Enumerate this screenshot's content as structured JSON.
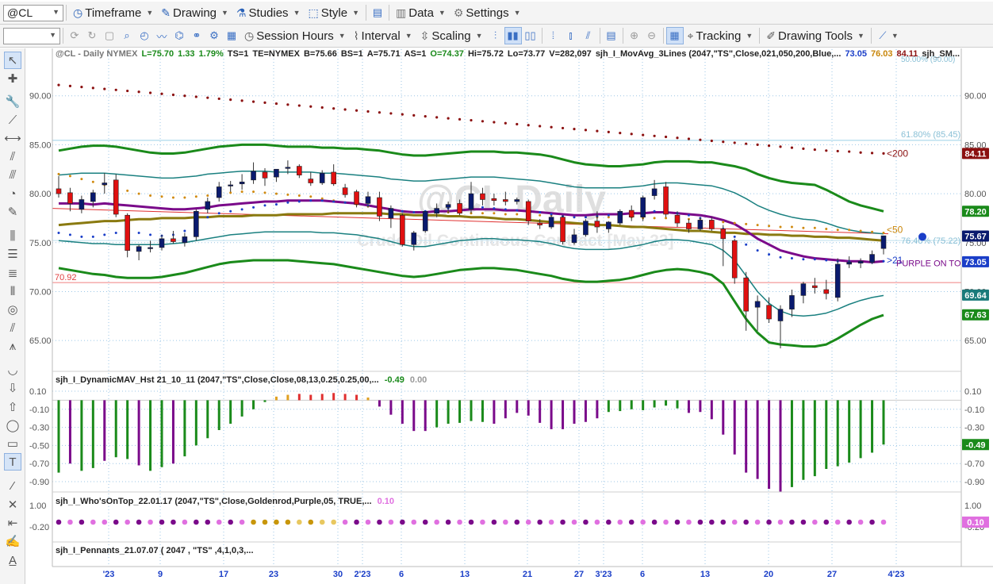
{
  "toolbar1": {
    "symbol": "@CL",
    "timeframe": "Timeframe",
    "drawing": "Drawing",
    "studies": "Studies",
    "style": "Style",
    "data": "Data",
    "settings": "Settings"
  },
  "toolbar2": {
    "session_hours": "Session Hours",
    "interval": "Interval",
    "scaling": "Scaling",
    "tracking": "Tracking",
    "drawing_tools": "Drawing Tools"
  },
  "watermark": {
    "title": "@CL Daily",
    "subtitle": "Crude Oil Continuous Contract [May 23]"
  },
  "info_bar": [
    {
      "text": "@CL - Daily  NYMEX",
      "color": "#777777"
    },
    {
      "text": "L=75.70",
      "color": "#1a8a1a"
    },
    {
      "text": "1.33",
      "color": "#1a8a1a"
    },
    {
      "text": "1.79%",
      "color": "#1a8a1a"
    },
    {
      "text": "TS=1",
      "color": "#222222"
    },
    {
      "text": "TE=NYMEX",
      "color": "#222222"
    },
    {
      "text": "B=75.66",
      "color": "#222222"
    },
    {
      "text": "BS=1",
      "color": "#222222"
    },
    {
      "text": "A=75.71",
      "color": "#222222"
    },
    {
      "text": "AS=1",
      "color": "#222222"
    },
    {
      "text": "O=74.37",
      "color": "#1a8a1a"
    },
    {
      "text": "Hi=75.72",
      "color": "#222222"
    },
    {
      "text": "Lo=73.77",
      "color": "#222222"
    },
    {
      "text": "V=282,097",
      "color": "#222222"
    },
    {
      "text": "sjh_I_MovAvg_3Lines (2047,\"TS\",Close,021,050,200,Blue,...",
      "color": "#222222"
    },
    {
      "text": "73.05",
      "color": "#1a3ec8"
    },
    {
      "text": "76.03",
      "color": "#c8860a"
    },
    {
      "text": "84.11",
      "color": "#8b1010"
    },
    {
      "text": "sjh_SM...",
      "color": "#222222"
    }
  ],
  "price_axis": {
    "ticks": [
      "90.00",
      "85.00",
      "80.00",
      "75.00",
      "70.00",
      "65.00"
    ],
    "min": 62.5,
    "max": 93.3,
    "badges": [
      {
        "text": "84.11",
        "value": 84.11,
        "bg": "#8b1010"
      },
      {
        "text": "78.20",
        "value": 78.2,
        "bg": "#1a8a1a"
      },
      {
        "text": "75.67",
        "value": 75.67,
        "bg": "#0a1a6e"
      },
      {
        "text": "73.05",
        "value": 73.05,
        "bg": "#1a3ec8"
      },
      {
        "text": "69.64",
        "value": 69.64,
        "bg": "#1a7a7a"
      },
      {
        "text": "67.63",
        "value": 67.63,
        "bg": "#1a8a1a"
      }
    ]
  },
  "annotations": {
    "fib_618": "61.80% (85.45)",
    "fib_partial": "76.40% (75.22)",
    "top_partial": "50.00% (90.00)",
    "level_label": "70.92",
    "ma200": "<200",
    "ma50": "<50",
    "ma21": ">21",
    "purple_on_top": "PURPLE ON TO"
  },
  "x_axis": {
    "labels": [
      {
        "text": "'23",
        "pos": 137
      },
      {
        "text": "9",
        "pos": 202
      },
      {
        "text": "17",
        "pos": 282
      },
      {
        "text": "23",
        "pos": 345
      },
      {
        "text": "30",
        "pos": 426
      },
      {
        "text": "2'23",
        "pos": 457
      },
      {
        "text": "6",
        "pos": 506
      },
      {
        "text": "13",
        "pos": 586
      },
      {
        "text": "21",
        "pos": 665
      },
      {
        "text": "27",
        "pos": 730
      },
      {
        "text": "3'23",
        "pos": 761
      },
      {
        "text": "6",
        "pos": 810
      },
      {
        "text": "13",
        "pos": 889
      },
      {
        "text": "20",
        "pos": 969
      },
      {
        "text": "27",
        "pos": 1049
      },
      {
        "text": "4'23",
        "pos": 1130
      }
    ]
  },
  "osc_panel": {
    "label": "sjh_I_DynamicMAV_Hst 21_10_11 (2047,\"TS\",Close,Close,08,13,0.25,0.25,00,...",
    "value1": "-0.49",
    "value2": "0.00",
    "ticks": [
      "0.10",
      "-0.10",
      "-0.30",
      "-0.50",
      "-0.70",
      "-0.90"
    ],
    "badge": "-0.49"
  },
  "who_panel": {
    "label": "sjh_I_Who'sOnTop_22.01.17 (2047,\"TS\",Close,Goldenrod,Purple,05, TRUE,...",
    "value": "0.10",
    "ticks": [
      "1.00",
      "-0.20"
    ],
    "badge": "0.10"
  },
  "pennant_panel": {
    "label": "sjh_I_Pennants_21.07.07 ( 2047 , \"TS\" ,4,1,0,3,..."
  },
  "colors": {
    "bull": "#0a1a6e",
    "bear": "#e01010",
    "ma_purple": "#7a0a8a",
    "ma_olive": "#8a7a10",
    "band_green": "#1a8a1a",
    "band_teal": "#1a8080",
    "dot_red": "#8b1010",
    "dot_gold": "#d08a10",
    "dot_blue": "#1a3ec8"
  },
  "chart_data": {
    "type": "candlestick",
    "note_axes": "price panel",
    "ohlc": [
      [
        80.5,
        81.8,
        79.6,
        80.0
      ],
      [
        80.1,
        80.6,
        78.2,
        79.0
      ],
      [
        78.4,
        79.8,
        78.0,
        79.4
      ],
      [
        79.2,
        80.4,
        78.6,
        80.1
      ],
      [
        80.9,
        82.1,
        80.0,
        81.1
      ],
      [
        81.4,
        82.0,
        77.6,
        77.9
      ],
      [
        77.8,
        78.0,
        73.5,
        74.2
      ],
      [
        74.1,
        74.8,
        73.2,
        74.6
      ],
      [
        74.4,
        75.2,
        74.0,
        74.5
      ],
      [
        74.5,
        75.8,
        74.2,
        75.4
      ],
      [
        75.4,
        76.2,
        74.9,
        75.1
      ],
      [
        75.0,
        76.0,
        74.6,
        75.6
      ],
      [
        75.6,
        78.4,
        75.2,
        78.2
      ],
      [
        78.4,
        79.6,
        78.0,
        79.2
      ],
      [
        79.6,
        81.2,
        79.2,
        80.7
      ],
      [
        80.8,
        81.3,
        80.2,
        80.9
      ],
      [
        81.0,
        82.0,
        80.4,
        81.2
      ],
      [
        81.4,
        83.2,
        81.0,
        82.3
      ],
      [
        82.2,
        82.6,
        80.8,
        81.6
      ],
      [
        81.7,
        82.5,
        81.2,
        82.5
      ],
      [
        82.6,
        83.4,
        82.0,
        82.7
      ],
      [
        82.8,
        83.0,
        81.6,
        81.9
      ],
      [
        81.5,
        82.2,
        80.8,
        81.1
      ],
      [
        81.1,
        82.4,
        80.9,
        82.1
      ],
      [
        82.2,
        83.0,
        80.8,
        81.0
      ],
      [
        80.6,
        81.0,
        79.6,
        79.9
      ],
      [
        80.2,
        80.4,
        78.6,
        78.9
      ],
      [
        79.0,
        80.2,
        78.6,
        79.7
      ],
      [
        79.6,
        80.2,
        77.2,
        77.7
      ],
      [
        77.5,
        78.8,
        76.5,
        78.5
      ],
      [
        77.8,
        78.0,
        74.6,
        74.8
      ],
      [
        74.8,
        76.2,
        74.2,
        76.0
      ],
      [
        76.2,
        78.2,
        76.0,
        78.2
      ],
      [
        78.0,
        79.0,
        77.6,
        78.5
      ],
      [
        78.6,
        79.2,
        78.0,
        78.9
      ],
      [
        79.0,
        79.4,
        77.8,
        78.0
      ],
      [
        78.4,
        81.2,
        78.0,
        80.0
      ],
      [
        80.0,
        80.6,
        78.8,
        79.4
      ],
      [
        79.5,
        80.0,
        78.8,
        79.3
      ],
      [
        79.4,
        80.2,
        78.8,
        79.2
      ],
      [
        79.2,
        79.6,
        78.9,
        79.4
      ],
      [
        79.2,
        79.4,
        76.8,
        77.2
      ],
      [
        77.0,
        77.4,
        76.4,
        76.8
      ],
      [
        76.6,
        77.8,
        76.4,
        77.6
      ],
      [
        77.6,
        77.8,
        74.8,
        75.1
      ],
      [
        75.0,
        76.4,
        74.8,
        75.8
      ],
      [
        75.8,
        77.4,
        75.6,
        77.2
      ],
      [
        77.2,
        78.2,
        76.0,
        76.6
      ],
      [
        76.4,
        77.2,
        76.0,
        77.1
      ],
      [
        77.0,
        78.4,
        76.8,
        78.2
      ],
      [
        78.3,
        78.8,
        77.2,
        77.6
      ],
      [
        77.6,
        79.8,
        77.2,
        79.6
      ],
      [
        79.8,
        81.4,
        79.4,
        80.5
      ],
      [
        80.7,
        81.2,
        77.6,
        77.9
      ],
      [
        77.8,
        78.2,
        76.6,
        77.0
      ],
      [
        77.0,
        77.4,
        76.0,
        76.4
      ],
      [
        76.4,
        77.6,
        76.2,
        77.3
      ],
      [
        77.3,
        77.6,
        76.2,
        76.4
      ],
      [
        76.4,
        76.8,
        72.6,
        75.4
      ],
      [
        75.2,
        75.4,
        70.8,
        71.4
      ],
      [
        71.4,
        72.0,
        66.0,
        68.0
      ],
      [
        68.4,
        69.6,
        66.0,
        69.0
      ],
      [
        68.6,
        69.4,
        66.8,
        67.2
      ],
      [
        67.0,
        68.6,
        64.2,
        68.2
      ],
      [
        68.2,
        70.2,
        67.4,
        69.6
      ],
      [
        69.6,
        71.0,
        68.8,
        70.8
      ],
      [
        70.6,
        71.4,
        69.8,
        70.4
      ],
      [
        70.2,
        71.2,
        69.2,
        69.8
      ],
      [
        69.4,
        73.4,
        69.0,
        72.8
      ],
      [
        72.8,
        73.6,
        72.4,
        73.0
      ],
      [
        72.9,
        73.4,
        72.4,
        73.1
      ],
      [
        73.0,
        74.2,
        72.8,
        73.8
      ],
      [
        74.4,
        75.7,
        73.8,
        75.7
      ]
    ],
    "ma21": [
      79.0,
      79.0,
      79.0,
      78.9,
      79.0,
      78.9,
      78.8,
      78.7,
      78.6,
      78.5,
      78.4,
      78.4,
      78.5,
      78.6,
      78.8,
      78.9,
      79.0,
      79.1,
      79.2,
      79.2,
      79.3,
      79.3,
      79.3,
      79.3,
      79.2,
      79.1,
      79.0,
      78.8,
      78.6,
      78.4,
      78.2,
      78.1,
      78.1,
      78.2,
      78.2,
      78.3,
      78.4,
      78.4,
      78.4,
      78.3,
      78.3,
      78.2,
      78.1,
      78.0,
      77.9,
      77.8,
      77.8,
      77.9,
      77.9,
      77.9,
      78.0,
      78.0,
      78.1,
      78.1,
      78.0,
      77.9,
      77.8,
      77.6,
      77.3,
      76.9,
      76.2,
      75.4,
      74.8,
      74.2,
      73.9,
      73.6,
      73.4,
      73.3,
      73.2,
      73.1,
      73.1,
      73.0,
      73.1
    ],
    "ma50": [
      77.6,
      77.7,
      77.8,
      77.9,
      78.0,
      78.0,
      78.1,
      78.2,
      78.2,
      78.3,
      78.3,
      78.3,
      78.4,
      78.4,
      78.5,
      78.5,
      78.5,
      78.6,
      78.6,
      78.6,
      78.7,
      78.7,
      78.7,
      78.7,
      78.8,
      78.8,
      78.8,
      78.8,
      78.8,
      78.7,
      78.7,
      78.6,
      78.6,
      78.6,
      78.5,
      78.5,
      78.4,
      78.4,
      78.3,
      78.2,
      78.2,
      78.1,
      78.0,
      77.9,
      77.9,
      77.8,
      77.7,
      77.6,
      77.6,
      77.5,
      77.4,
      77.4,
      77.3,
      77.2,
      77.1,
      77.0,
      77.0,
      76.9,
      76.8,
      76.8,
      76.7,
      76.7,
      76.6,
      76.6,
      76.5,
      76.5,
      76.4,
      76.4,
      76.3,
      76.3,
      76.2,
      76.1,
      76.0
    ],
    "ma200": [
      91.1,
      91.0,
      90.9,
      90.8,
      90.7,
      90.6,
      90.5,
      90.4,
      90.3,
      90.2,
      90.1,
      90.0,
      89.9,
      89.8,
      89.7,
      89.6,
      89.5,
      89.4,
      89.3,
      89.2,
      89.1,
      89.0,
      88.9,
      88.8,
      88.7,
      88.6,
      88.5,
      88.4,
      88.3,
      88.2,
      88.1,
      88.0,
      87.9,
      87.8,
      87.7,
      87.6,
      87.5,
      87.4,
      87.3,
      87.2,
      87.1,
      87.0,
      86.9,
      86.8,
      86.7,
      86.6,
      86.5,
      86.4,
      86.3,
      86.2,
      86.1,
      86.0,
      85.9,
      85.8,
      85.7,
      85.6,
      85.5,
      85.4,
      85.3,
      85.2,
      85.1,
      85.0,
      84.9,
      84.8,
      84.7,
      84.6,
      84.5,
      84.4,
      84.35,
      84.3,
      84.2,
      84.15,
      84.11
    ],
    "band_outer_upper": [
      84.4,
      84.6,
      84.8,
      84.9,
      84.9,
      84.8,
      84.6,
      84.4,
      84.2,
      84.1,
      84.1,
      84.2,
      84.4,
      84.6,
      84.8,
      84.9,
      85.0,
      85.0,
      85.0,
      84.9,
      84.8,
      84.8,
      84.8,
      84.7,
      84.7,
      84.6,
      84.6,
      84.5,
      84.4,
      84.2,
      84.0,
      83.9,
      83.9,
      84.0,
      84.1,
      84.2,
      84.3,
      84.3,
      84.3,
      84.2,
      84.2,
      84.1,
      84.0,
      83.8,
      83.5,
      83.2,
      83.0,
      82.9,
      82.8,
      82.8,
      82.9,
      83.0,
      83.2,
      83.3,
      83.3,
      83.3,
      83.2,
      83.2,
      83.0,
      82.8,
      82.5,
      82.0,
      81.6,
      81.3,
      81.1,
      81.0,
      80.9,
      80.4,
      79.8,
      79.2,
      78.8,
      78.5,
      78.2
    ],
    "band_inner_upper": [
      81.9,
      82.0,
      82.1,
      82.1,
      82.1,
      82.0,
      81.9,
      81.8,
      81.7,
      81.6,
      81.6,
      81.7,
      81.8,
      82.0,
      82.1,
      82.2,
      82.3,
      82.3,
      82.3,
      82.2,
      82.2,
      82.2,
      82.2,
      82.1,
      82.1,
      82.0,
      81.9,
      81.8,
      81.7,
      81.5,
      81.4,
      81.3,
      81.3,
      81.4,
      81.5,
      81.6,
      81.7,
      81.7,
      81.7,
      81.6,
      81.5,
      81.4,
      81.3,
      81.1,
      80.9,
      80.7,
      80.6,
      80.6,
      80.6,
      80.6,
      80.7,
      80.8,
      81.0,
      81.1,
      81.1,
      81.0,
      80.9,
      80.8,
      80.5,
      80.1,
      79.5,
      78.8,
      78.3,
      77.9,
      77.6,
      77.4,
      77.3,
      77.0,
      76.6,
      76.3,
      76.1,
      76.0,
      75.9
    ],
    "band_inner_lower": [
      75.2,
      75.1,
      75.0,
      74.9,
      74.9,
      74.8,
      74.8,
      74.8,
      74.8,
      74.8,
      74.9,
      75.0,
      75.2,
      75.4,
      75.6,
      75.8,
      75.9,
      76.0,
      76.1,
      76.1,
      76.1,
      76.1,
      76.1,
      76.0,
      76.0,
      75.9,
      75.8,
      75.6,
      75.4,
      75.1,
      74.8,
      74.6,
      74.6,
      74.8,
      75.0,
      75.2,
      75.3,
      75.4,
      75.4,
      75.3,
      75.3,
      75.2,
      75.1,
      74.9,
      74.6,
      74.4,
      74.3,
      74.3,
      74.3,
      74.4,
      74.6,
      74.8,
      75.1,
      75.3,
      75.3,
      75.2,
      75.0,
      74.8,
      74.2,
      73.2,
      71.6,
      70.0,
      68.8,
      68.0,
      67.6,
      67.5,
      67.6,
      67.8,
      68.2,
      68.7,
      69.1,
      69.4,
      69.6
    ],
    "band_outer_lower": [
      72.4,
      72.2,
      72.0,
      71.8,
      71.7,
      71.5,
      71.4,
      71.4,
      71.4,
      71.5,
      71.7,
      71.9,
      72.2,
      72.5,
      72.8,
      73.0,
      73.1,
      73.2,
      73.2,
      73.2,
      73.2,
      73.1,
      73.0,
      72.9,
      72.8,
      72.6,
      72.4,
      72.2,
      72.0,
      71.8,
      71.6,
      71.5,
      71.6,
      71.8,
      72.0,
      72.2,
      72.3,
      72.4,
      72.4,
      72.3,
      72.2,
      72.0,
      71.8,
      71.6,
      71.3,
      71.1,
      71.0,
      71.0,
      71.1,
      71.2,
      71.4,
      71.7,
      72.0,
      72.2,
      72.3,
      72.2,
      72.0,
      71.7,
      70.8,
      69.0,
      67.2,
      65.8,
      64.8,
      64.6,
      64.5,
      64.4,
      64.4,
      64.6,
      65.2,
      65.9,
      66.6,
      67.2,
      67.6
    ],
    "dots_blue": [
      76.0,
      75.8,
      75.6,
      75.6,
      75.8,
      76.0,
      76.1,
      76.0,
      75.8,
      75.7,
      75.8,
      76.2,
      76.9,
      77.6,
      78.0,
      78.2,
      78.4,
      78.6,
      78.8,
      78.9,
      79.1,
      79.2,
      79.3,
      79.3,
      79.2,
      79.1,
      79.0,
      78.8,
      78.6,
      78.4,
      78.2,
      78.1,
      78.2,
      78.4,
      78.5,
      78.6,
      78.6,
      78.6,
      78.5,
      78.4,
      78.3,
      78.2,
      78.1,
      77.9,
      77.7,
      77.6,
      77.6,
      77.7,
      77.8,
      77.9,
      78.0,
      78.1,
      78.2,
      78.2,
      78.0,
      77.8,
      77.5,
      77.0,
      76.4,
      75.6,
      74.8,
      74.2,
      73.8,
      73.5,
      73.4,
      73.3,
      73.3,
      73.2,
      73.1,
      73.1,
      73.0,
      73.0,
      73.1
    ],
    "dots_gold": [
      82.0,
      81.8,
      81.5,
      81.2,
      80.9,
      80.6,
      80.3,
      80.0,
      79.8,
      79.7,
      79.6,
      79.6,
      79.7,
      79.8,
      80.0,
      80.1,
      80.2,
      80.2,
      80.1,
      80.0,
      79.9,
      79.8,
      79.7,
      79.5,
      79.3,
      79.1,
      78.9,
      78.7,
      78.5,
      78.3,
      78.2,
      78.1,
      78.1,
      78.1,
      78.1,
      78.1,
      78.0,
      78.0,
      78.0,
      77.9,
      77.9,
      77.8,
      77.8,
      77.8,
      77.7,
      77.6,
      77.6,
      77.6,
      77.6,
      77.6,
      77.6,
      77.5,
      77.5,
      77.5,
      77.4,
      77.4,
      77.3,
      77.2,
      77.1,
      77.0,
      76.9,
      76.8,
      76.7,
      76.6,
      76.6,
      76.5,
      76.5,
      76.4,
      76.3,
      76.3,
      76.2,
      76.1,
      76.0
    ],
    "osc_hist": [
      -0.8,
      -0.7,
      -0.78,
      -0.75,
      -0.67,
      -0.63,
      -0.65,
      -0.72,
      -0.78,
      -0.74,
      -0.7,
      -0.62,
      -0.5,
      -0.42,
      -0.33,
      -0.26,
      -0.18,
      -0.1,
      -0.02,
      0.04,
      0.06,
      0.07,
      0.06,
      0.07,
      0.08,
      0.07,
      0.06,
      0.03,
      -0.07,
      -0.16,
      -0.26,
      -0.34,
      -0.34,
      -0.3,
      -0.26,
      -0.25,
      -0.23,
      -0.24,
      -0.26,
      -0.2,
      -0.14,
      -0.17,
      -0.25,
      -0.32,
      -0.32,
      -0.26,
      -0.24,
      -0.2,
      -0.13,
      -0.12,
      -0.1,
      -0.11,
      -0.08,
      -0.06,
      -0.09,
      -0.14,
      -0.13,
      -0.21,
      -0.38,
      -0.6,
      -0.8,
      -0.87,
      -0.98,
      -1.01,
      -0.96,
      -0.88,
      -0.84,
      -0.76,
      -0.73,
      -0.69,
      -0.64,
      -0.58,
      -0.49
    ],
    "who_dots": [
      "p",
      "lp",
      "p",
      "lp",
      "lp",
      "p",
      "lp",
      "p",
      "lp",
      "p",
      "p",
      "lp",
      "p",
      "p",
      "lp",
      "p",
      "lp",
      "g",
      "g",
      "g",
      "g",
      "lg",
      "g",
      "lg",
      "lg",
      "lp",
      "p",
      "lp",
      "p",
      "lp",
      "p",
      "lp",
      "p",
      "lp",
      "p",
      "lp",
      "p",
      "lp",
      "p",
      "lp",
      "p",
      "lp",
      "p",
      "lp",
      "p",
      "lp",
      "p",
      "lp",
      "p",
      "lp",
      "p",
      "lp",
      "p",
      "lp",
      "p",
      "lp",
      "p",
      "p",
      "p",
      "lp",
      "p",
      "lp",
      "p",
      "lp",
      "p",
      "p",
      "lp",
      "p",
      "lp",
      "p",
      "lp",
      "p",
      "lp"
    ]
  }
}
